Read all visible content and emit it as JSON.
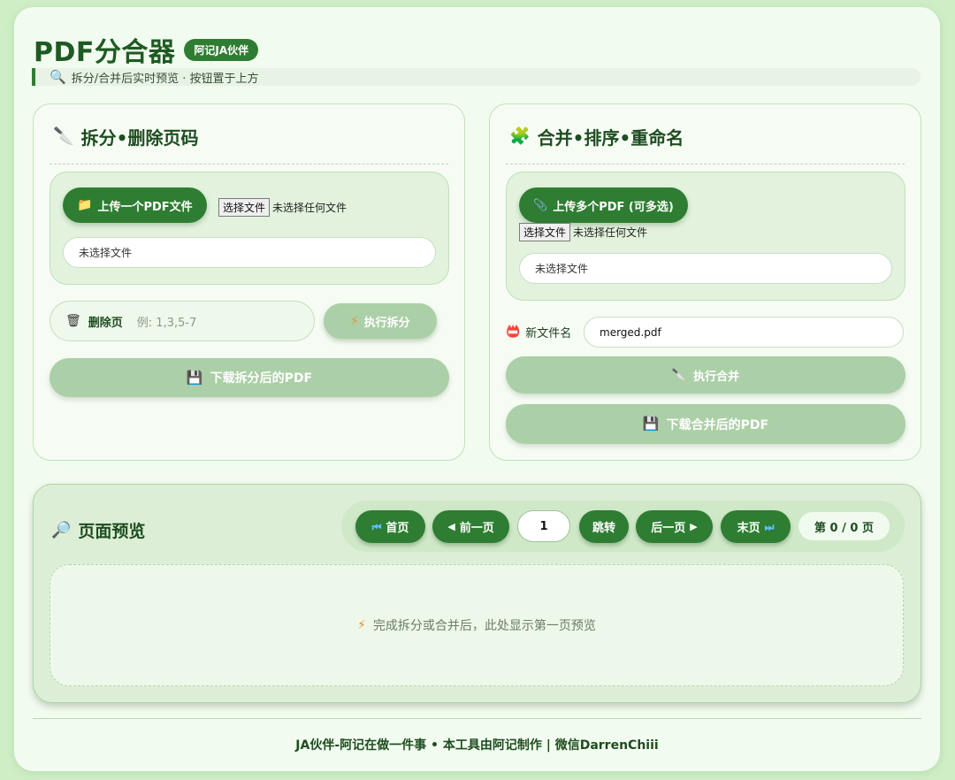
{
  "header": {
    "title": "PDF分合器",
    "badge": "阿记JA伙伴"
  },
  "subbar": {
    "icon": "magnifier-icon",
    "text": "拆分/合并后实时预览 · 按钮置于上方"
  },
  "split": {
    "title": "拆分•删除页码",
    "title_icon": "knife-icon",
    "upload_label": "上传一个PDF文件",
    "upload_icon": "folder-icon",
    "file_button": "选择文件",
    "file_status": "未选择任何文件",
    "selected_file": "未选择文件",
    "delete_label": "删除页",
    "delete_placeholder": "例: 1,3,5-7",
    "run_label": "执行拆分",
    "download_label": "下载拆分后的PDF"
  },
  "merge": {
    "title": "合并•排序•重命名",
    "title_icon": "puzzle-icon",
    "upload_label": "上传多个PDF (可多选)",
    "upload_icon": "paperclip-icon",
    "file_button": "选择文件",
    "file_status": "未选择任何文件",
    "selected_file": "未选择文件",
    "filename_label": "新文件名",
    "filename_value": "merged.pdf",
    "run_label": "执行合并",
    "download_label": "下载合并后的PDF"
  },
  "preview": {
    "title": "页面预览",
    "title_icon": "magnifier-icon",
    "first": "首页",
    "prev": "前一页",
    "page_value": "1",
    "jump": "跳转",
    "next": "后一页",
    "last": "末页",
    "indicator": "第 0 / 0 页",
    "placeholder": "完成拆分或合并后，此处显示第一页预览"
  },
  "footer": {
    "text": "JA伙伴-阿记在做一件事 • 本工具由阿记制作 | 微信DarrenChiii"
  },
  "colors": {
    "primary": "#2e7d32",
    "disabled": "#abcfa6",
    "background": "#f2fbef"
  }
}
